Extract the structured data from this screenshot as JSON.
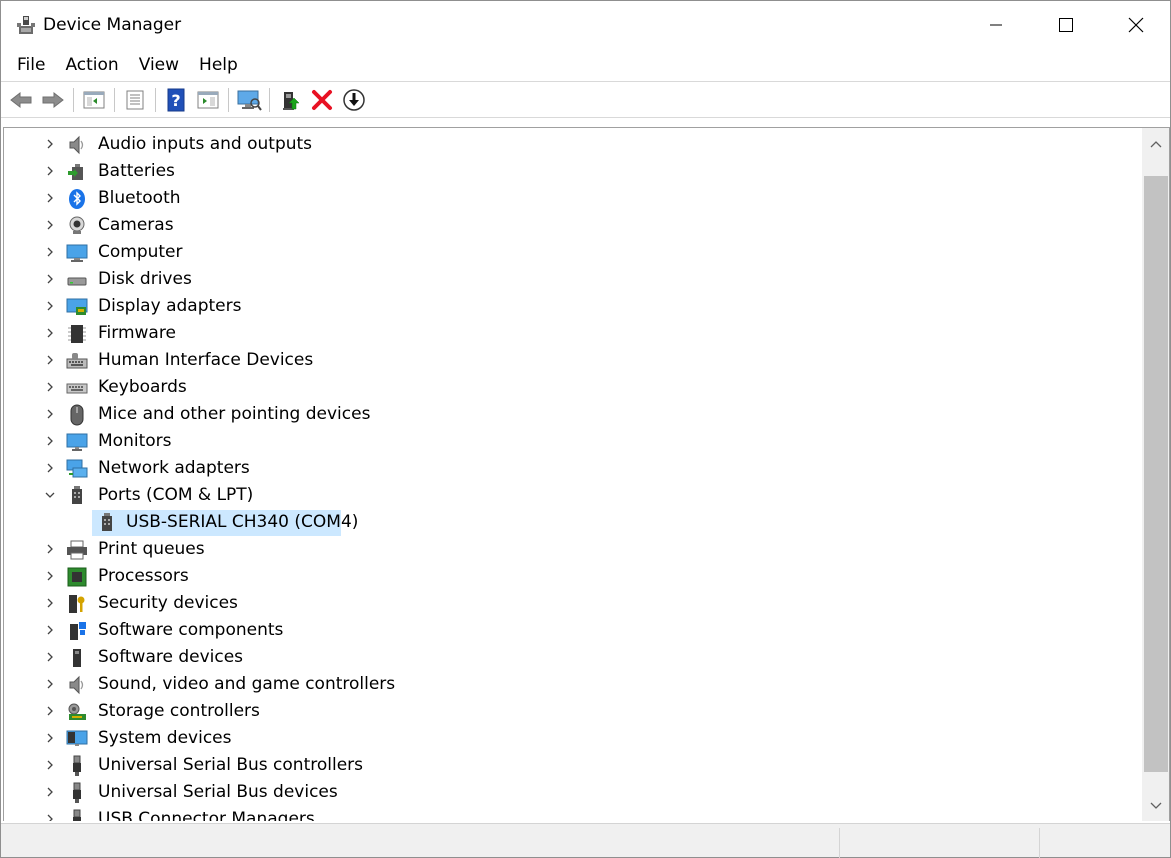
{
  "window": {
    "title": "Device Manager"
  },
  "menu": [
    "File",
    "Action",
    "View",
    "Help"
  ],
  "toolbar": {
    "buttons": [
      "back-icon",
      "forward-icon",
      "show-hide-console-tree-icon",
      "properties-icon",
      "help-icon",
      "action-pane-icon",
      "scan-hardware-icon",
      "update-driver-icon",
      "uninstall-device-icon",
      "disable-device-icon"
    ]
  },
  "tree": {
    "items": [
      {
        "label": "Audio inputs and outputs",
        "icon": "speaker-icon",
        "expanded": false
      },
      {
        "label": "Batteries",
        "icon": "battery-icon",
        "expanded": false
      },
      {
        "label": "Bluetooth",
        "icon": "bluetooth-icon",
        "expanded": false
      },
      {
        "label": "Cameras",
        "icon": "camera-icon",
        "expanded": false
      },
      {
        "label": "Computer",
        "icon": "computer-icon",
        "expanded": false
      },
      {
        "label": "Disk drives",
        "icon": "disk-drive-icon",
        "expanded": false
      },
      {
        "label": "Display adapters",
        "icon": "display-adapter-icon",
        "expanded": false
      },
      {
        "label": "Firmware",
        "icon": "firmware-icon",
        "expanded": false
      },
      {
        "label": "Human Interface Devices",
        "icon": "hid-icon",
        "expanded": false
      },
      {
        "label": "Keyboards",
        "icon": "keyboard-icon",
        "expanded": false
      },
      {
        "label": "Mice and other pointing devices",
        "icon": "mouse-icon",
        "expanded": false
      },
      {
        "label": "Monitors",
        "icon": "monitor-icon",
        "expanded": false
      },
      {
        "label": "Network adapters",
        "icon": "network-adapter-icon",
        "expanded": false
      },
      {
        "label": "Ports (COM & LPT)",
        "icon": "port-icon",
        "expanded": true,
        "children": [
          {
            "label": "USB-SERIAL CH340 (COM4)",
            "icon": "port-icon",
            "selected": true
          }
        ]
      },
      {
        "label": "Print queues",
        "icon": "printer-icon",
        "expanded": false
      },
      {
        "label": "Processors",
        "icon": "processor-icon",
        "expanded": false
      },
      {
        "label": "Security devices",
        "icon": "security-device-icon",
        "expanded": false
      },
      {
        "label": "Software components",
        "icon": "software-component-icon",
        "expanded": false
      },
      {
        "label": "Software devices",
        "icon": "software-device-icon",
        "expanded": false
      },
      {
        "label": "Sound, video and game controllers",
        "icon": "speaker-icon",
        "expanded": false
      },
      {
        "label": "Storage controllers",
        "icon": "storage-controller-icon",
        "expanded": false
      },
      {
        "label": "System devices",
        "icon": "system-device-icon",
        "expanded": false
      },
      {
        "label": "Universal Serial Bus controllers",
        "icon": "usb-icon",
        "expanded": false
      },
      {
        "label": "Universal Serial Bus devices",
        "icon": "usb-icon",
        "expanded": false
      },
      {
        "label": "USB Connector Managers",
        "icon": "usb-icon",
        "expanded": false
      }
    ]
  },
  "colors": {
    "selection": "#cce8ff",
    "accent_blue": "#0078d7",
    "delete_red": "#e81123"
  }
}
